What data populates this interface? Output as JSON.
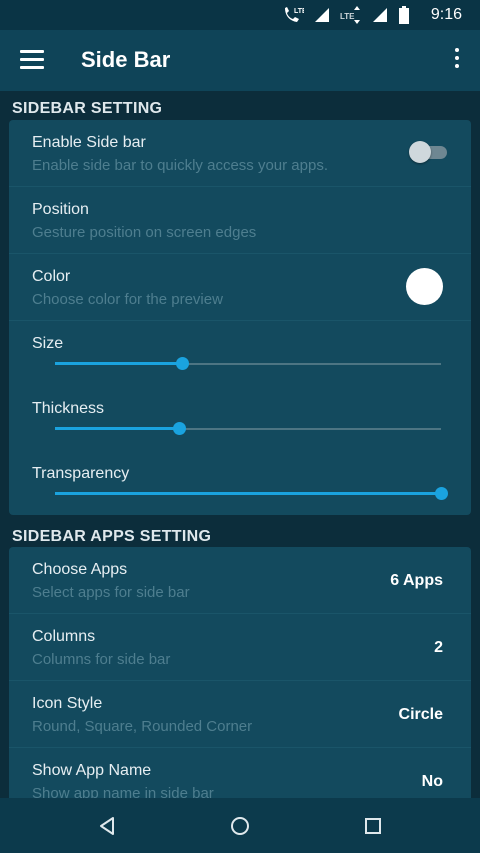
{
  "status_bar": {
    "time": "9:16",
    "icons": [
      "phone-lte-icon",
      "signal-icon",
      "lte-icon",
      "signal-icon",
      "battery-icon"
    ],
    "lte_label": "LTE"
  },
  "app_bar": {
    "title": "Side Bar",
    "icons": [
      "menu-icon",
      "more-vert-icon"
    ]
  },
  "sidebar_setting": {
    "header": "SIDEBAR SETTING",
    "enable": {
      "title": "Enable Side bar",
      "subtitle": "Enable side bar to quickly access your apps.",
      "enabled": false
    },
    "position": {
      "title": "Position",
      "subtitle": "Gesture position on screen edges"
    },
    "color": {
      "title": "Color",
      "subtitle": "Choose color for the preview",
      "swatch": "#ffffff"
    },
    "size": {
      "title": "Size",
      "level_fraction": 0.33
    },
    "thickness": {
      "title": "Thickness",
      "level_fraction": 0.32
    },
    "transparency": {
      "title": "Transparency",
      "level_fraction": 1.0
    }
  },
  "sidebar_apps_setting": {
    "header": "SIDEBAR APPS SETTING",
    "rows": [
      {
        "title": "Choose Apps",
        "subtitle": "Select apps for side bar",
        "value": "6 Apps"
      },
      {
        "title": "Columns",
        "subtitle": "Columns for side bar",
        "value": "2"
      },
      {
        "title": "Icon Style",
        "subtitle": "Round, Square, Rounded Corner",
        "value": "Circle"
      },
      {
        "title": "Show App Name",
        "subtitle": "Show app name in side bar",
        "value": "No"
      }
    ]
  },
  "nav_bar": {
    "icons": [
      "back-icon",
      "home-icon",
      "recents-icon"
    ]
  },
  "colors": {
    "accent": "#1aa3df",
    "background": "#0c2d3b",
    "card": "#134a5e",
    "app_bar": "#0f4458"
  }
}
